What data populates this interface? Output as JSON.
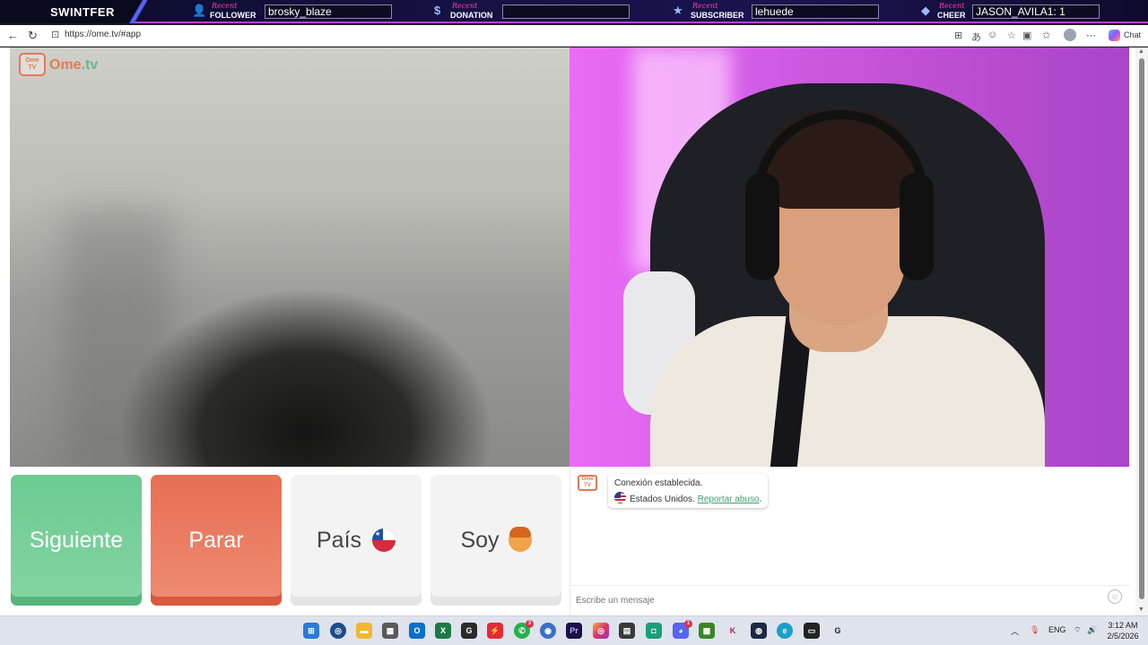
{
  "overlay": {
    "brand": "SWINTFER",
    "recent": "Recent",
    "follower": {
      "label": "FOLLOWER",
      "value": "brosky_blaze"
    },
    "donation": {
      "label": "DONATION",
      "value": ""
    },
    "subscriber": {
      "label": "SUBSCRIBER",
      "value": "lehuede"
    },
    "cheer": {
      "label": "CHEER",
      "value": "JASON_AVILA1: 1"
    },
    "accent_color": "#c23bd6"
  },
  "browser": {
    "url": "https://ome.tv/#app",
    "chat_button": "Chat"
  },
  "site": {
    "logo_tv": "Ome TV",
    "logo_main": "Ome",
    "logo_tld": ".tv"
  },
  "buttons": {
    "next": "Siguiente",
    "stop": "Parar",
    "country": "País",
    "gender": "Soy"
  },
  "chat": {
    "logo": "Ome TV",
    "status": "Conexión establecida.",
    "country": "Estados Unidos.",
    "report_link": "Reportar abuso",
    "report_suffix": ".",
    "input_placeholder": "Escribe un mensaje"
  },
  "taskbar": {
    "language": "ENG",
    "time": "3:12 AM",
    "date": "2/5/2026",
    "apps": [
      "windows-start",
      "search",
      "file-explorer",
      "outlook",
      "excel",
      "app-g",
      "app-red",
      "whatsapp",
      "app-globe",
      "premiere",
      "instagram",
      "app-mix",
      "app-green",
      "discord",
      "minecraft",
      "app-k",
      "steam",
      "edge",
      "app-dark",
      "app-g2"
    ],
    "whatsapp_badge": "3",
    "discord_badge": "1"
  },
  "colors": {
    "next_button": "#6ccb91",
    "stop_button": "#e76f52",
    "neutral_button": "#f3f3f3",
    "brand_orange": "#e27a54",
    "link_green": "#3f9e73"
  }
}
